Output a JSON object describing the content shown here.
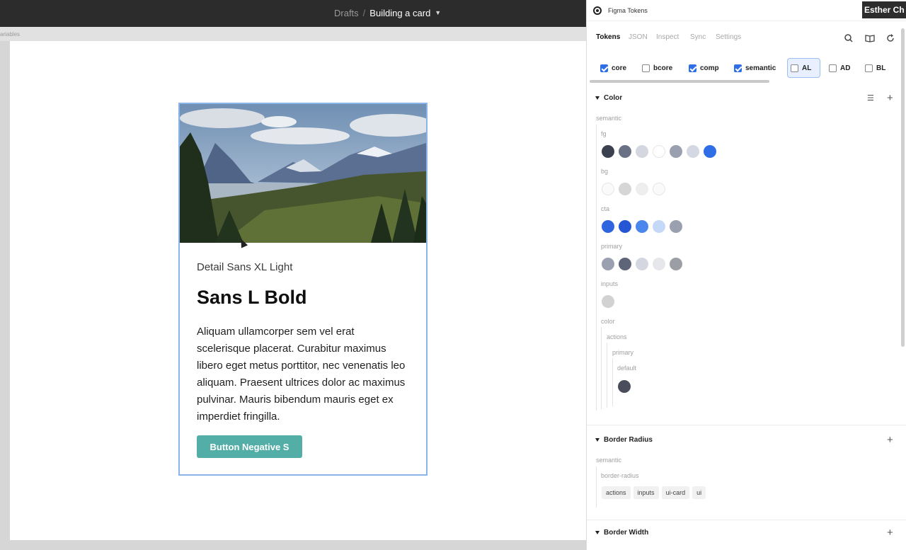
{
  "topbar": {
    "breadcrumb_parent": "Drafts",
    "breadcrumb_separator": "/",
    "file_name": "Building a card"
  },
  "strip": {
    "label": "ariables"
  },
  "card": {
    "detail": "Detail Sans XL Light",
    "heading": "Sans L Bold",
    "body": "Aliquam ullamcorper sem vel erat scelerisque placerat. Curabitur maximus libero eget metus porttitor, nec venenatis leo aliquam. Praesent ultrices dolor ac maximus pulvinar. Mauris bibendum mauris eget ex imperdiet fringilla.",
    "button": "Button Negative S",
    "button_color": "#52aea6"
  },
  "user": {
    "name": "Esther Ch"
  },
  "panel": {
    "title": "Figma Tokens",
    "tabs": [
      "Tokens",
      "JSON",
      "Inspect",
      "Sync",
      "Settings"
    ],
    "active_tab": "Tokens",
    "tools": [
      "search-icon",
      "book-icon",
      "refresh-icon"
    ],
    "themes": [
      {
        "label": "core",
        "checked": true
      },
      {
        "label": "bcore",
        "checked": false
      },
      {
        "label": "comp",
        "checked": true
      },
      {
        "label": "semantic",
        "checked": true
      },
      {
        "label": "AL",
        "checked": false,
        "selected": true
      },
      {
        "label": "AD",
        "checked": false
      },
      {
        "label": "BL",
        "checked": false
      }
    ],
    "color_section": {
      "title": "Color",
      "group": "semantic",
      "fg": {
        "label": "fg",
        "swatches": [
          "#3c4150",
          "#6b7185",
          "#d4d7df",
          "#ffffff",
          "#9aa0b0",
          "#d4d8e2",
          "#2f6ee6"
        ]
      },
      "bg": {
        "label": "bg",
        "swatches": [
          "#fafafa",
          "#d6d6d6",
          "#eeeeee",
          "#fafafa"
        ]
      },
      "cta": {
        "label": "cta",
        "swatches": [
          "#2f66e0",
          "#2456d4",
          "#4a86ec",
          "#c6d8f8",
          "#9aa0b0"
        ]
      },
      "primary": {
        "label": "primary",
        "swatches": [
          "#9aa0b0",
          "#5f6579",
          "#d4d7df",
          "#e6e7ea",
          "#9c9ea5"
        ]
      },
      "inputs": {
        "label": "inputs",
        "swatches": [
          "#d2d2d2"
        ]
      },
      "color": {
        "label": "color",
        "actions": "actions",
        "primary": "primary",
        "default": "default",
        "swatches": [
          "#4a4d5c"
        ]
      }
    },
    "border_radius_section": {
      "title": "Border Radius",
      "group": "semantic",
      "subgroup": "border-radius",
      "tokens": [
        "actions",
        "inputs",
        "ui-card",
        "ui"
      ]
    },
    "border_width_section": {
      "title": "Border Width"
    }
  }
}
